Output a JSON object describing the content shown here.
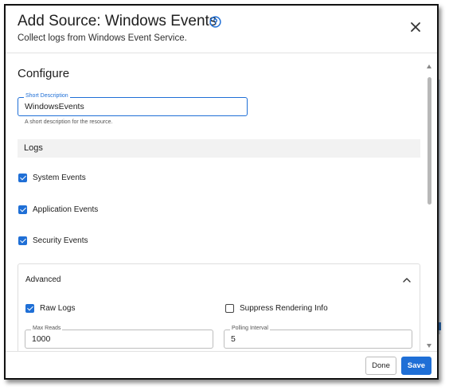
{
  "dialog": {
    "title": "Add Source: Windows Events",
    "subtitle": "Collect logs from Windows Event Service."
  },
  "icons": {
    "help": "help-circle-icon",
    "close": "close-icon",
    "chevron": "chevron-up-icon"
  },
  "configure": {
    "section_title": "Configure",
    "short_description": {
      "label": "Short Description",
      "value": "WindowsEvents",
      "helper": "A short description for the resource."
    }
  },
  "logs": {
    "heading": "Logs",
    "items": [
      {
        "label": "System Events",
        "checked": true
      },
      {
        "label": "Application Events",
        "checked": true
      },
      {
        "label": "Security Events",
        "checked": true
      }
    ]
  },
  "advanced": {
    "heading": "Advanced",
    "expanded": true,
    "raw_logs": {
      "label": "Raw Logs",
      "checked": true
    },
    "suppress_rendering": {
      "label": "Suppress Rendering Info",
      "checked": false
    },
    "max_reads": {
      "label": "Max Reads",
      "value": "1000"
    },
    "polling_interval": {
      "label": "Polling Interval",
      "value": "5"
    }
  },
  "footer": {
    "done_label": "Done",
    "save_label": "Save"
  },
  "colors": {
    "accent": "#1f6fd6",
    "checkbox_checked": "#1f6fd6",
    "section_bar": "#f2f2f2"
  }
}
